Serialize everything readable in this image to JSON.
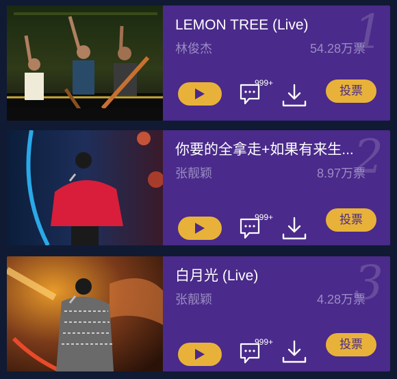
{
  "songs": [
    {
      "rank": "1",
      "title": "LEMON TREE (Live)",
      "artist": "林俊杰",
      "votes": "54.28万票",
      "comment_count": "999+",
      "vote_label": "投票"
    },
    {
      "rank": "2",
      "title": "你要的全拿走+如果有来生...",
      "artist": "张靓颖",
      "votes": "8.97万票",
      "comment_count": "999+",
      "vote_label": "投票"
    },
    {
      "rank": "3",
      "title": "白月光 (Live)",
      "artist": "张靓颖",
      "votes": "4.28万票",
      "comment_count": "999+",
      "vote_label": "投票"
    }
  ],
  "colors": {
    "background": "#101a33",
    "card": "#4a2a8a",
    "accent": "#e8b23a",
    "muted_text": "#9a8cc4"
  },
  "icons": [
    "play-icon",
    "comment-icon",
    "download-icon"
  ]
}
